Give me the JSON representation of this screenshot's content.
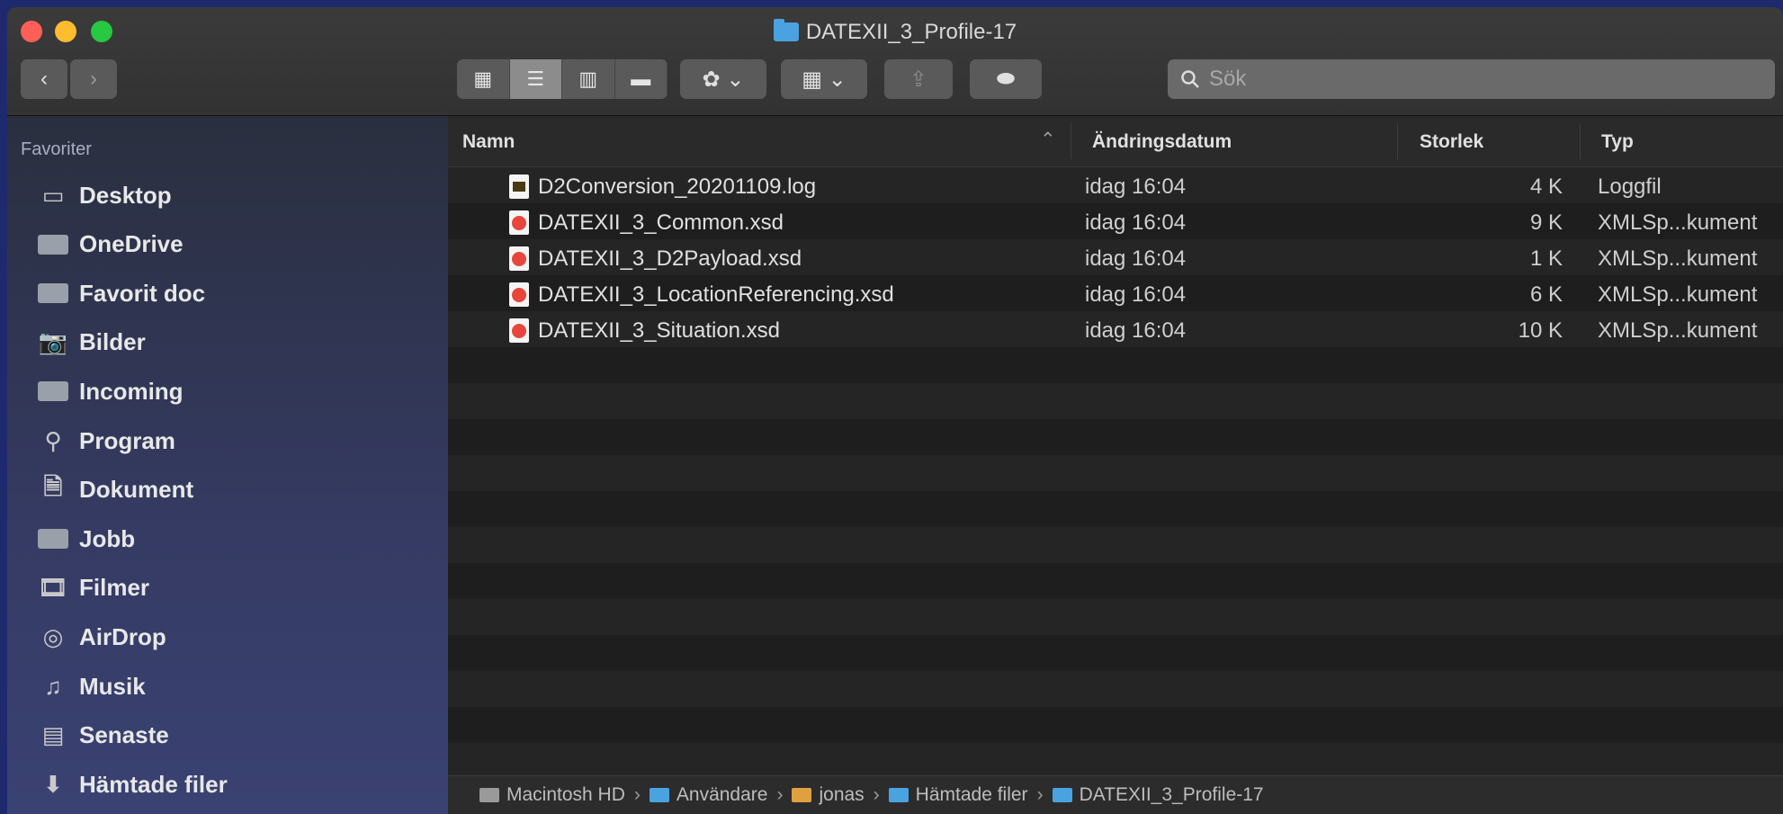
{
  "window": {
    "title": "DATEXII_3_Profile-17"
  },
  "toolbar": {
    "back_glyph": "‹",
    "forward_glyph": "›",
    "views": [
      {
        "icon": "icon-view-icon",
        "glyph": "▦",
        "selected": false
      },
      {
        "icon": "list-view-icon",
        "glyph": "☰",
        "selected": true
      },
      {
        "icon": "column-view-icon",
        "glyph": "▥",
        "selected": false
      },
      {
        "icon": "gallery-view-icon",
        "glyph": "▬",
        "selected": false
      }
    ],
    "action_glyph": "✿ ⌄",
    "arrange_glyph": "▦ ⌄",
    "share_glyph": "⇪",
    "tag_glyph": "⬬"
  },
  "search": {
    "placeholder": "Sök"
  },
  "sidebar": {
    "heading": "Favoriter",
    "items": [
      {
        "label": "Desktop",
        "icon": "desktop-icon",
        "glyph": "▭"
      },
      {
        "label": "OneDrive",
        "icon": "folder-icon",
        "glyph": ""
      },
      {
        "label": "Favorit doc",
        "icon": "folder-icon",
        "glyph": ""
      },
      {
        "label": "Bilder",
        "icon": "camera-icon",
        "glyph": "📷"
      },
      {
        "label": "Incoming",
        "icon": "folder-icon",
        "glyph": ""
      },
      {
        "label": "Program",
        "icon": "applications-icon",
        "glyph": "⚲"
      },
      {
        "label": "Dokument",
        "icon": "document-icon",
        "glyph": "🗎"
      },
      {
        "label": "Jobb",
        "icon": "folder-icon",
        "glyph": ""
      },
      {
        "label": "Filmer",
        "icon": "film-icon",
        "glyph": "🎞"
      },
      {
        "label": "AirDrop",
        "icon": "airdrop-icon",
        "glyph": "◎"
      },
      {
        "label": "Musik",
        "icon": "music-icon",
        "glyph": "♫"
      },
      {
        "label": "Senaste",
        "icon": "recents-icon",
        "glyph": "▤"
      },
      {
        "label": "Hämtade filer",
        "icon": "downloads-icon",
        "glyph": "⬇"
      }
    ]
  },
  "columns": {
    "name": "Namn",
    "date": "Ändringsdatum",
    "size": "Storlek",
    "type": "Typ",
    "sort_glyph": "⌃"
  },
  "files": [
    {
      "name": "D2Conversion_20201109.log",
      "date": "idag 16:04",
      "size": "4 K",
      "type": "Loggfil",
      "kind": "log"
    },
    {
      "name": "DATEXII_3_Common.xsd",
      "date": "idag 16:04",
      "size": "9 K",
      "type": "XMLSp...kument",
      "kind": "xsd"
    },
    {
      "name": "DATEXII_3_D2Payload.xsd",
      "date": "idag 16:04",
      "size": "1 K",
      "type": "XMLSp...kument",
      "kind": "xsd"
    },
    {
      "name": "DATEXII_3_LocationReferencing.xsd",
      "date": "idag 16:04",
      "size": "6 K",
      "type": "XMLSp...kument",
      "kind": "xsd"
    },
    {
      "name": "DATEXII_3_Situation.xsd",
      "date": "idag 16:04",
      "size": "10 K",
      "type": "XMLSp...kument",
      "kind": "xsd"
    }
  ],
  "pathbar": [
    {
      "label": "Macintosh HD",
      "icon": "hard-drive-icon",
      "color": "#9a9a9a"
    },
    {
      "label": "Användare",
      "icon": "folder-icon",
      "color": "#4aa3e0"
    },
    {
      "label": "jonas",
      "icon": "home-icon",
      "color": "#e0a040"
    },
    {
      "label": "Hämtade filer",
      "icon": "folder-icon",
      "color": "#4aa3e0"
    },
    {
      "label": "DATEXII_3_Profile-17",
      "icon": "folder-icon",
      "color": "#4aa3e0"
    }
  ],
  "pathbar_sep": "›"
}
